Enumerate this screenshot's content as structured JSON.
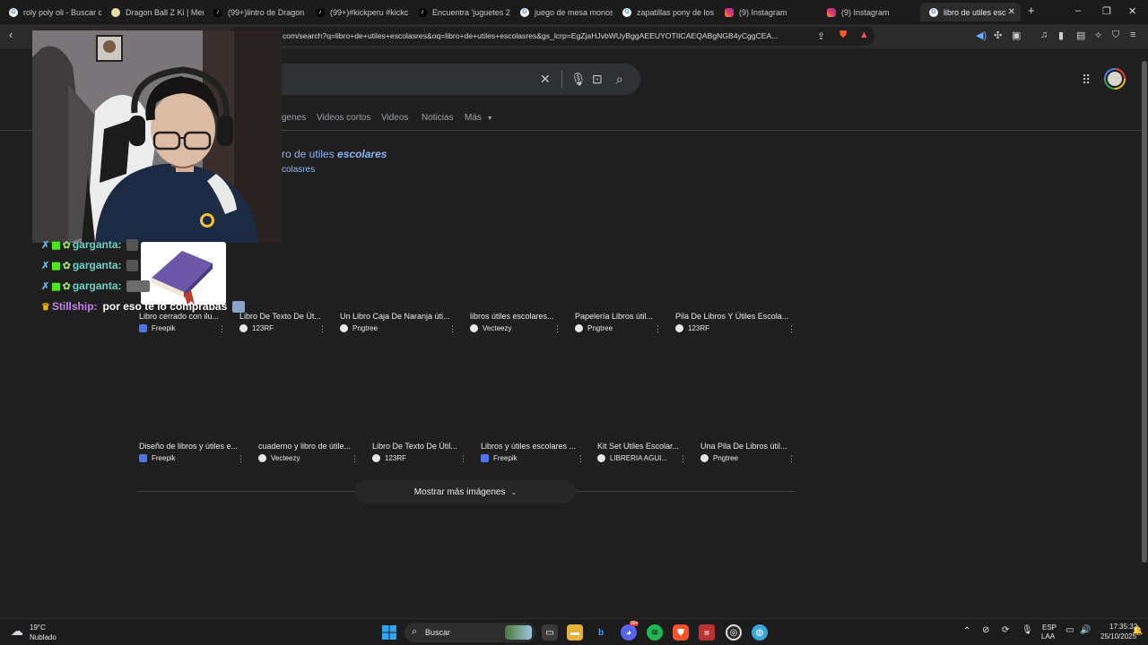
{
  "browser": {
    "tabs": [
      {
        "label": "roly poly oli - Buscar c",
        "icon": "google-icon"
      },
      {
        "label": "Dragon Ball Z Ki | Men",
        "icon": "site-icon"
      },
      {
        "label": "(99+)lintro de Dragon",
        "icon": "tiktok-icon"
      },
      {
        "label": "(99+)#kickperu #kickc",
        "icon": "tiktok-icon"
      },
      {
        "label": "Encuentra 'juguetes 20",
        "icon": "tiktok-icon"
      },
      {
        "label": "juego de mesa monos",
        "icon": "google-icon"
      },
      {
        "label": "zapatillas pony de los",
        "icon": "google-icon"
      },
      {
        "label": "(9) Instagram",
        "icon": "instagram-icon"
      },
      {
        "label": "(9) Instagram",
        "icon": "instagram-icon"
      },
      {
        "label": "libro de utiles esc",
        "icon": "google-icon",
        "active": true
      }
    ],
    "new_tab": "+",
    "url": "com/search?q=libro+de+utiles+escolasres&oq=libro+de+utiles+escolasres&gs_lcrp=EgZjaHJvbWUyBggAEEUYOTIICAEQABgNGB4yCggCEA..."
  },
  "search": {
    "nav_tabs": [
      "genes",
      "Videos cortos",
      "Videos",
      "Noticias",
      "Más"
    ],
    "suggestion_prefix": "ro de utiles",
    "suggestion_emph": "escolares",
    "suggestion_sub": "colasres",
    "row1": [
      {
        "title": "Libro cerrado con ilu...",
        "source": "Freepik"
      },
      {
        "title": "Libro De Texto De Út...",
        "source": "123RF"
      },
      {
        "title": "Un Libro Caja De Naranja úti...",
        "source": "Pngtree"
      },
      {
        "title": "libros útiles escolares...",
        "source": "Vecteezy"
      },
      {
        "title": "Papelería Libros útil...",
        "source": "Pngtree"
      },
      {
        "title": "Pila De Libros Y Útiles Escola...",
        "source": "123RF"
      }
    ],
    "row2": [
      {
        "title": "Diseño de libros y útiles e...",
        "source": "Freepik"
      },
      {
        "title": "cuaderno y libro de útile...",
        "source": "Vecteezy"
      },
      {
        "title": "Libro De Texto De Útil...",
        "source": "123RF"
      },
      {
        "title": "Libros y útiles escolares ...",
        "source": "Freepik"
      },
      {
        "title": "Kit Set Utiles Escolar...",
        "source": "LIBRERIA AGUI..."
      },
      {
        "title": "Una Pila De Libros útil...",
        "source": "Pngtree"
      }
    ],
    "show_more": "Mostrar más imágenes"
  },
  "chat": {
    "lines": [
      {
        "user": "garganta:"
      },
      {
        "user": "garganta:"
      },
      {
        "user": "garganta:"
      }
    ],
    "last": {
      "user": "Stillship:",
      "message": "por eso te lo comprabas"
    }
  },
  "taskbar": {
    "weather_temp": "19°C",
    "weather_desc": "Nublado",
    "search_label": "Buscar",
    "lang_top": "ESP",
    "lang_bottom": "LAA",
    "time": "17:35:32",
    "date": "25/10/2025",
    "discord_badge": "99+"
  },
  "colors": {
    "page_bg": "#1f1f1f",
    "link": "#8ab4f8",
    "chat_name": "#6ad3c8",
    "chat_name_2": "#c580f0"
  }
}
